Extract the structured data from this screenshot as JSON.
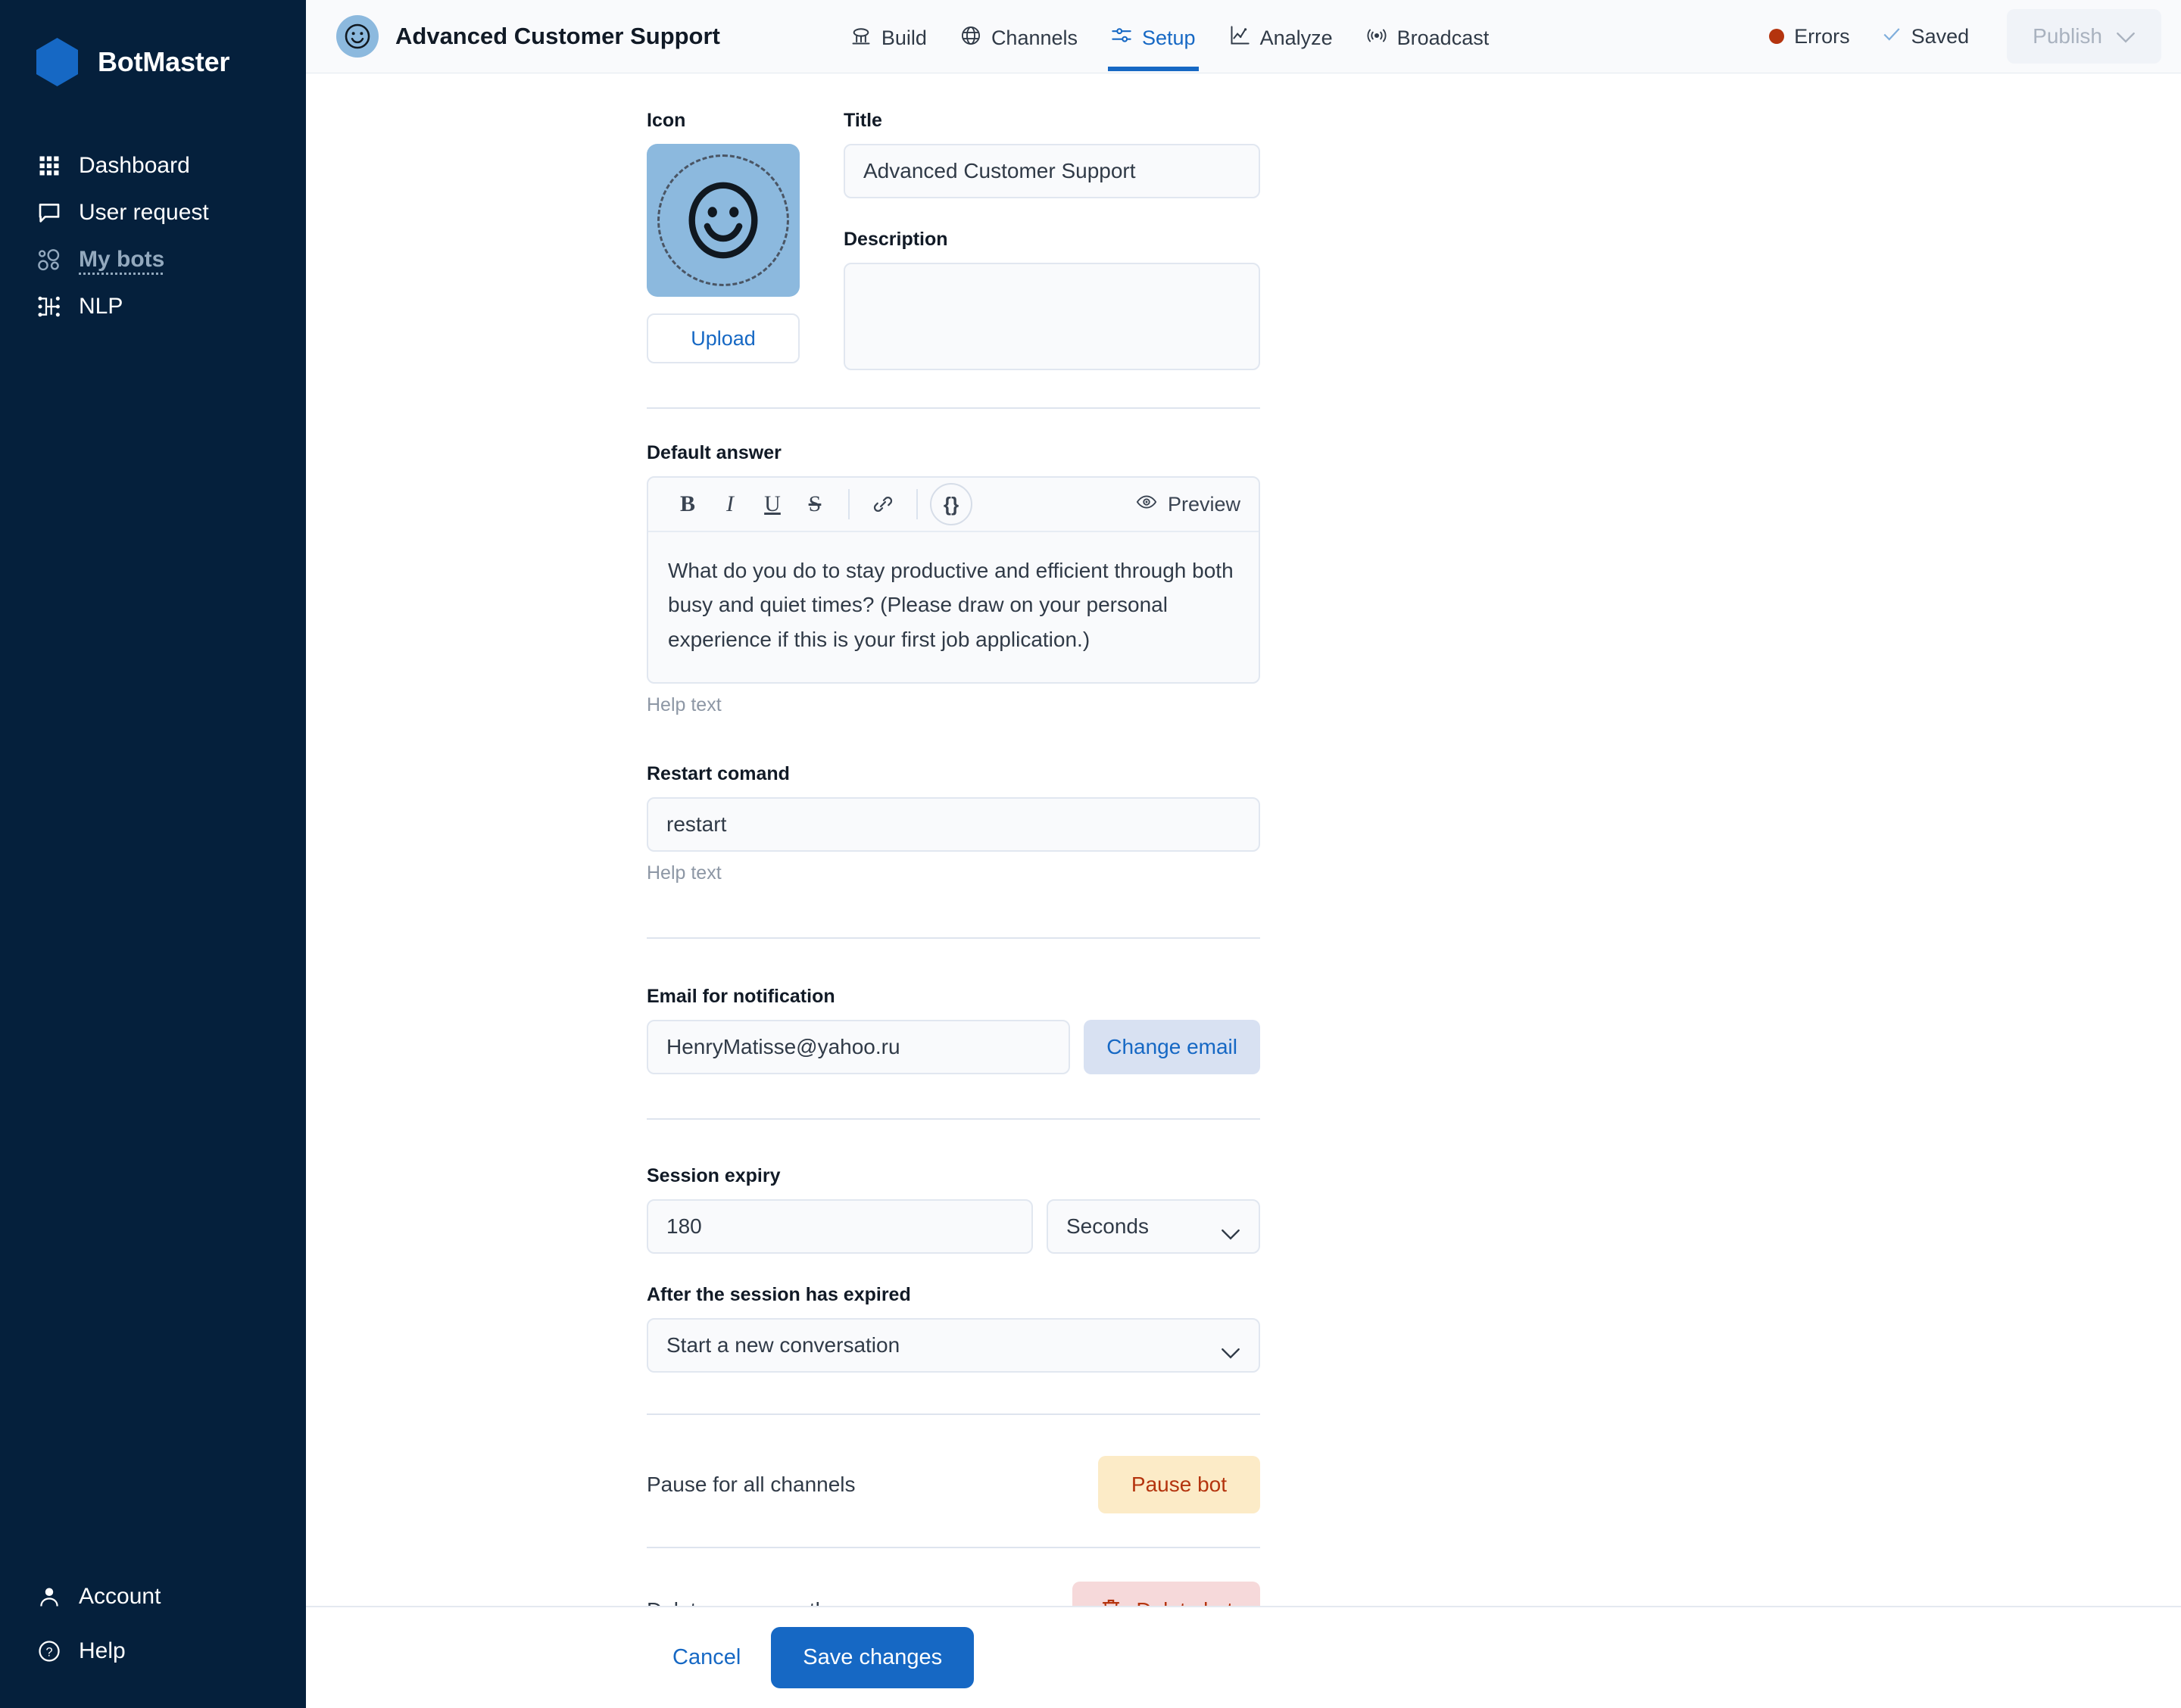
{
  "brand": {
    "name": "BotMaster",
    "logo_icon": "hexagon-logo-icon",
    "logo_color": "#1668C4"
  },
  "sidebar": {
    "items": [
      {
        "label": "Dashboard",
        "icon": "grid-icon",
        "active": false
      },
      {
        "label": "User request",
        "icon": "chat-bubble-icon",
        "active": false
      },
      {
        "label": "My bots",
        "icon": "bots-circles-icon",
        "active": true
      },
      {
        "label": "NLP",
        "icon": "nodes-icon",
        "active": false
      }
    ],
    "bottom_items": [
      {
        "label": "Account",
        "icon": "user-icon"
      },
      {
        "label": "Help",
        "icon": "question-circle-icon"
      }
    ]
  },
  "topbar": {
    "bot_avatar_icon": "smiley-face-icon",
    "bot_title": "Advanced Customer Support",
    "nav": [
      {
        "label": "Build",
        "icon": "build-icon",
        "active": false
      },
      {
        "label": "Channels",
        "icon": "globe-icon",
        "active": false
      },
      {
        "label": "Setup",
        "icon": "sliders-icon",
        "active": true
      },
      {
        "label": "Analyze",
        "icon": "chart-icon",
        "active": false
      },
      {
        "label": "Broadcast",
        "icon": "broadcast-icon",
        "active": false
      }
    ],
    "errors_label": "Errors",
    "errors_dot_color": "#B4340E",
    "saved_label": "Saved",
    "saved_icon": "check-icon",
    "publish_label": "Publish",
    "publish_caret_icon": "chevron-down-icon",
    "publish_disabled": true
  },
  "form": {
    "icon_label": "Icon",
    "upload_label": "Upload",
    "title_label": "Title",
    "title_value": "Advanced Customer Support",
    "title_placeholder": "",
    "description_label": "Description",
    "description_value": "",
    "description_placeholder": "",
    "default_answer_label": "Default answer",
    "editor_toolbar": {
      "bold": "B",
      "italic": "I",
      "underline": "U",
      "strikethrough": "S",
      "link_icon": "link-icon",
      "variable": "{}",
      "preview_label": "Preview",
      "preview_icon": "eye-icon"
    },
    "default_answer_value": "What do you do to stay productive and efficient through both busy and quiet times? (Please draw on your personal experience if this is your first job application.)",
    "default_answer_help": "Help text",
    "restart_label": "Restart comand",
    "restart_value": "restart",
    "restart_help": "Help text",
    "email_label": "Email for notification",
    "email_value": "HenryMatisse@yahoo.ru",
    "change_email_label": "Change email",
    "session_expiry_label": "Session expiry",
    "session_expiry_value": "180",
    "session_unit_value": "Seconds",
    "after_expiry_label": "After the session has expired",
    "after_expiry_value": "Start a new conversation",
    "pause_row_label": "Pause for all channels",
    "pause_button_label": "Pause bot",
    "delete_row_label": "Delete permanently",
    "delete_button_label": "Delete bot",
    "delete_button_icon": "trash-icon"
  },
  "footer": {
    "cancel_label": "Cancel",
    "save_label": "Save changes"
  },
  "colors": {
    "sidebar_bg": "#05203C",
    "accent": "#1668C4",
    "avatar_blue": "#8CB9DE",
    "danger": "#B4340E",
    "warn_bg": "#FCEBC7",
    "danger_bg": "#F6D9DA"
  }
}
